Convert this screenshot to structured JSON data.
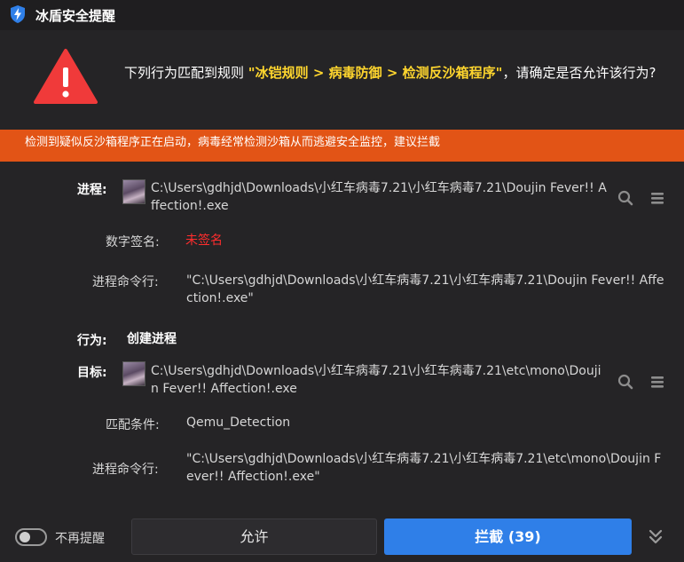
{
  "window": {
    "title": "冰盾安全提醒"
  },
  "alert": {
    "prefix": "下列行为匹配到规则 ",
    "rule": "\"冰铠规则 > 病毒防御 > 检测反沙箱程序\"",
    "suffix": "，请确定是否允许该行为?"
  },
  "banner": {
    "text": "检测到疑似反沙箱程序正在启动，病毒经常检测沙箱从而逃避安全监控，建议拦截"
  },
  "process": {
    "label": "进程:",
    "path": "C:\\Users\\gdhjd\\Downloads\\小红车病毒7.21\\小红车病毒7.21\\Doujin Fever!! Affection!.exe",
    "signature_label": "数字签名:",
    "signature_value": "未签名",
    "cmd_label": "进程命令行:",
    "cmd_value": "\"C:\\Users\\gdhjd\\Downloads\\小红车病毒7.21\\小红车病毒7.21\\Doujin Fever!! Affection!.exe\""
  },
  "behavior": {
    "label": "行为:",
    "value": "创建进程"
  },
  "target": {
    "label": "目标:",
    "path": "C:\\Users\\gdhjd\\Downloads\\小红车病毒7.21\\小红车病毒7.21\\etc\\mono\\Doujin Fever!! Affection!.exe",
    "match_label": "匹配条件:",
    "match_value": "Qemu_Detection",
    "cmd_label": "进程命令行:",
    "cmd_value": "\"C:\\Users\\gdhjd\\Downloads\\小红车病毒7.21\\小红车病毒7.21\\etc\\mono\\Doujin Fever!! Affection!.exe\""
  },
  "footer": {
    "toggle_label": "不再提醒",
    "allow_label": "允许",
    "block_label": "拦截 (39)"
  },
  "colors": {
    "background": "#252426",
    "banner": "#e25416",
    "rule_highlight": "#ffd62e",
    "unsigned": "#ff2d2d",
    "primary_button": "#2f7fe8"
  },
  "icons": [
    "shield-bolt-icon",
    "warning-triangle-icon",
    "search-icon",
    "menu-icon",
    "double-chevron-down-icon"
  ]
}
